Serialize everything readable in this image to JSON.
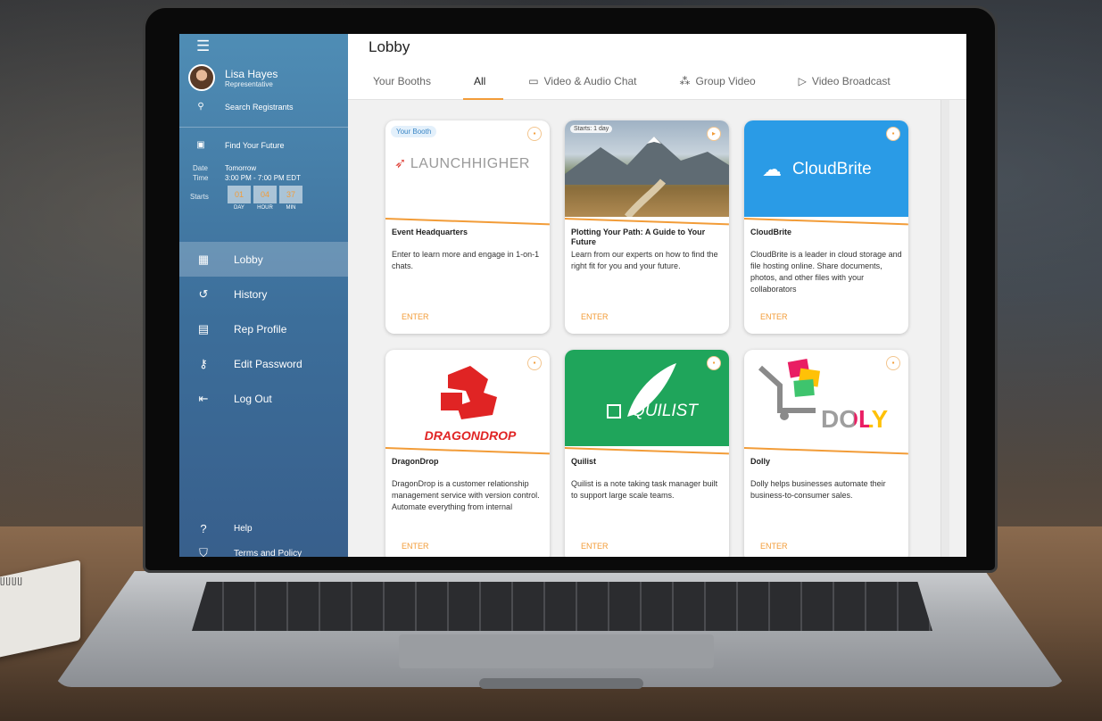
{
  "colors": {
    "accent": "#f29c38",
    "sidebar": "#4a82ad",
    "cloudbrite": "#2a9be6",
    "quilist": "#1fa55b",
    "dragon": "#e02424"
  },
  "notebook": {
    "rings": "ᥩᥩᥩᥩ"
  },
  "sidebar": {
    "menu_icon": "☰",
    "user": {
      "name": "Lisa Hayes",
      "role": "Representative"
    },
    "search_registrants": "Search Registrants",
    "event": {
      "title": "Find Your Future",
      "date_label": "Date",
      "date_value": "Tomorrow",
      "time_label": "Time",
      "time_value": "3:00 PM - 7:00 PM EDT",
      "starts_label": "Starts",
      "countdown": [
        {
          "value": "01",
          "unit": "DAY"
        },
        {
          "value": "04",
          "unit": "HOUR"
        },
        {
          "value": "37",
          "unit": "MIN"
        }
      ]
    },
    "nav": [
      {
        "label": "Lobby",
        "icon": "dashboard-icon"
      },
      {
        "label": "History",
        "icon": "history-icon"
      },
      {
        "label": "Rep Profile",
        "icon": "badge-icon"
      },
      {
        "label": "Edit Password",
        "icon": "key-icon"
      },
      {
        "label": "Log Out",
        "icon": "logout-icon"
      }
    ],
    "bottom": [
      {
        "label": "Help",
        "icon": "help-icon"
      },
      {
        "label": "Terms and Policy",
        "icon": "shield-icon"
      }
    ]
  },
  "header": {
    "title": "Lobby",
    "tabs": [
      {
        "label": "Your Booths",
        "icon": ""
      },
      {
        "label": "All",
        "icon": ""
      },
      {
        "label": "Video & Audio Chat",
        "icon": "chat-icon"
      },
      {
        "label": "Group Video",
        "icon": "group-icon"
      },
      {
        "label": "Video Broadcast",
        "icon": "broadcast-icon"
      }
    ],
    "active_tab": "All"
  },
  "booths": [
    {
      "title": "Event Headquarters",
      "desc": "Enter to learn more and engage in 1-on-1 chats.",
      "enter": "ENTER",
      "tag": "Your Booth",
      "logo_text": "LAUNCHHIGHER"
    },
    {
      "title": "Plotting Your Path: A Guide to Your Future",
      "desc": "Learn from our experts on how to find the right fit for you and your future.",
      "enter": "ENTER",
      "tag": "Starts: 1 day"
    },
    {
      "title": "CloudBrite",
      "desc": "CloudBrite is a leader in cloud storage and file hosting online. Share documents, photos, and other files with your collaborators",
      "enter": "ENTER",
      "logo_text": "CloudBrite"
    },
    {
      "title": "DragonDrop",
      "desc": "DragonDrop is a customer relationship management service with version control. Automate everything from internal",
      "enter": "ENTER",
      "logo_text": "DRAGONDROP"
    },
    {
      "title": "Quilist",
      "desc": "Quilist is a note taking task manager built to support large scale teams.",
      "enter": "ENTER",
      "logo_text": "QUILIST"
    },
    {
      "title": "Dolly",
      "desc": "Dolly helps businesses automate their business-to-consumer sales.",
      "enter": "ENTER",
      "logo_text": "DOLY"
    }
  ]
}
